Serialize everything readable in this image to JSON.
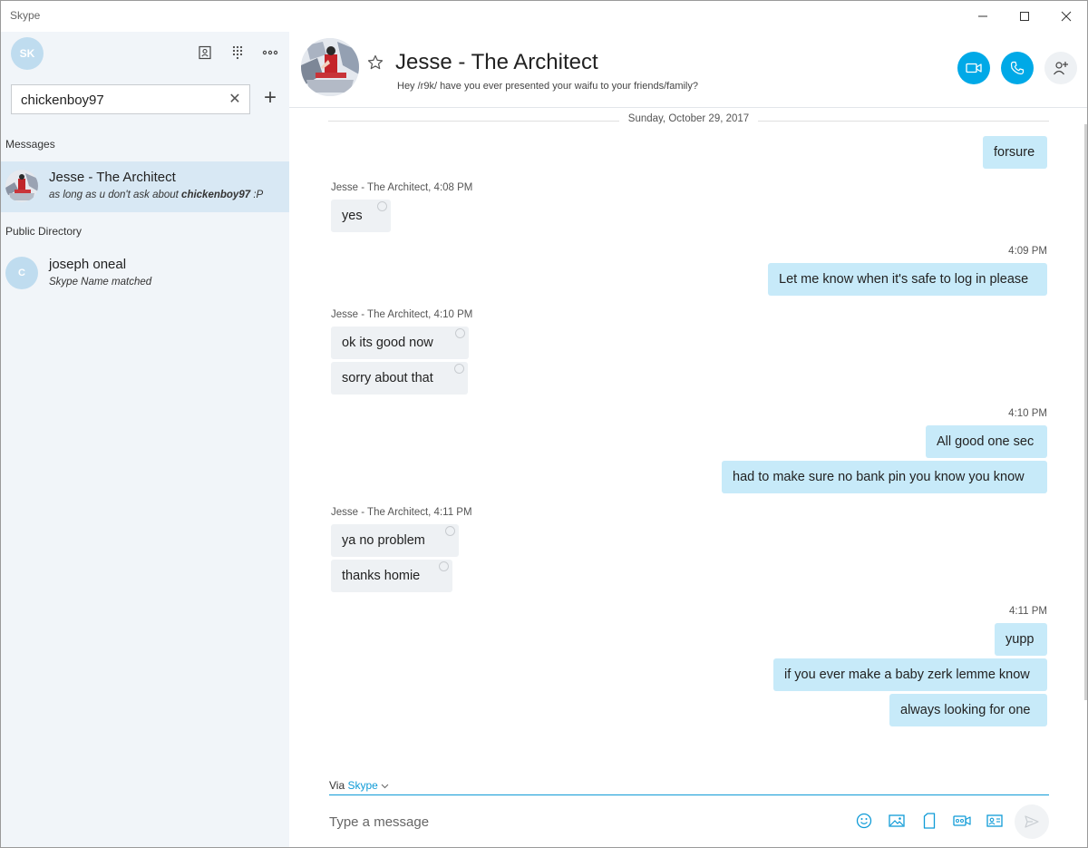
{
  "window": {
    "title": "Skype"
  },
  "sidebar": {
    "user_initials": "SK",
    "search": {
      "value": "chickenboy97",
      "clear_glyph": "✕"
    },
    "messages_label": "Messages",
    "public_directory_label": "Public Directory",
    "conversations": [
      {
        "name": "Jesse - The Architect",
        "preview_prefix": "as long as u don't ask about ",
        "preview_bold": "chickenboy97",
        "preview_suffix": " :P"
      }
    ],
    "directory": [
      {
        "initials": "C",
        "name": "joseph oneal",
        "subtitle": "Skype Name matched"
      }
    ]
  },
  "header": {
    "contact_name": "Jesse - The Architect",
    "mood": "Hey /r9k/ have you ever presented your waifu to your friends/family?"
  },
  "chat": {
    "date_separator": "Sunday, October 29, 2017",
    "groups": [
      {
        "dir": "out",
        "meta": "",
        "messages": [
          "forsure"
        ]
      },
      {
        "dir": "in",
        "meta": "Jesse - The Architect, 4:08 PM",
        "messages": [
          "yes"
        ]
      },
      {
        "dir": "out",
        "meta": "4:09 PM",
        "messages": [
          "Let me know when it's safe to log in please"
        ]
      },
      {
        "dir": "in",
        "meta": "Jesse - The Architect, 4:10 PM",
        "messages": [
          "ok its good now",
          "sorry about that"
        ]
      },
      {
        "dir": "out",
        "meta": "4:10 PM",
        "messages": [
          "All good one sec",
          "had to make sure no bank pin you know you know"
        ]
      },
      {
        "dir": "in",
        "meta": "Jesse - The Architect, 4:11 PM",
        "messages": [
          "ya no problem",
          "thanks homie"
        ]
      },
      {
        "dir": "out",
        "meta": "4:11 PM",
        "messages": [
          "yupp",
          "if you ever make a baby zerk lemme know",
          "always looking for one"
        ]
      }
    ]
  },
  "composer": {
    "via_label": "Via",
    "via_service": "Skype",
    "placeholder": "Type a message"
  },
  "colors": {
    "accent": "#00a9e7",
    "outgoing_bubble": "#c7eaf9",
    "incoming_bubble": "#eef1f4",
    "sidebar_bg": "#f1f5f9",
    "selected_row": "#d8e8f4"
  },
  "icons": {
    "titlebar": [
      "minimize-icon",
      "maximize-icon",
      "close-icon"
    ],
    "sidebar_toolbar": [
      "contacts-icon",
      "dialpad-icon",
      "more-icon"
    ],
    "header_actions": [
      "video-call-icon",
      "audio-call-icon",
      "add-people-icon"
    ],
    "composer": [
      "emoji-icon",
      "image-icon",
      "file-icon",
      "video-message-icon",
      "contact-card-icon",
      "send-icon"
    ]
  }
}
